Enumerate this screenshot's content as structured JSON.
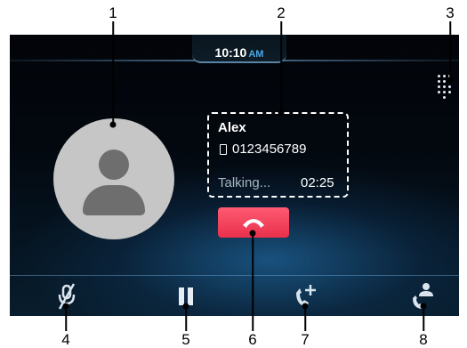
{
  "status_bar": {
    "time": "10:10",
    "ampm": "AM"
  },
  "caller": {
    "name": "Alex",
    "number": "0123456789",
    "status": "Talking...",
    "duration": "02:25"
  },
  "icons": {
    "dialpad": "dialpad-icon",
    "avatar": "person-icon",
    "end_call": "hang-up-icon",
    "mute": "mic-off-icon",
    "hold": "pause-icon",
    "add_call": "add-call-icon",
    "transfer": "handset-person-icon"
  },
  "callouts": [
    "1",
    "2",
    "3",
    "4",
    "5",
    "6",
    "7",
    "8"
  ],
  "colors": {
    "end_call": "#f0405b",
    "accent": "#4aa8e6",
    "background": "#03080f",
    "avatar_bg": "#c6c6c6",
    "avatar_fg": "#6e6e6e"
  }
}
